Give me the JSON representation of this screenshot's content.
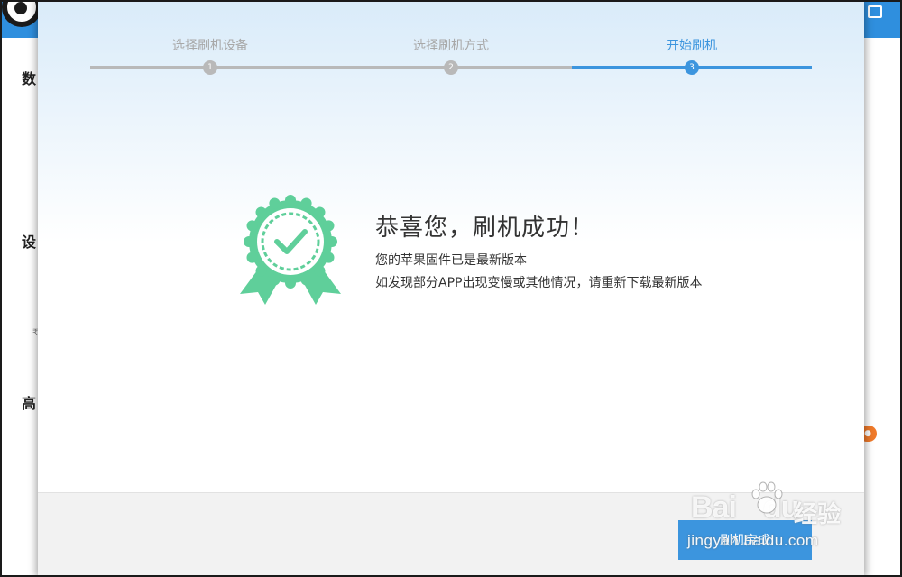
{
  "background_app": {
    "left_labels": [
      "数",
      "设",
      "高"
    ],
    "small_char": "₹"
  },
  "stepper": {
    "steps": [
      {
        "label": "选择刷机设备",
        "number": "1",
        "state": "done"
      },
      {
        "label": "选择刷机方式",
        "number": "2",
        "state": "done"
      },
      {
        "label": "开始刷机",
        "number": "3",
        "state": "active"
      }
    ]
  },
  "success": {
    "title": "恭喜您，刷机成功！",
    "line1": "您的苹果固件已是最新版本",
    "line2": "如发现部分APP出现变慢或其他情况，请重新下载最新版本",
    "icon": "award-check-icon"
  },
  "footer": {
    "finish_label": "刷机完成"
  },
  "watermark": {
    "brand": "Bai",
    "brand2": "du",
    "cn": "经验",
    "url": "jingyan.baidu.com"
  },
  "colors": {
    "accent": "#3c95de",
    "step_inactive": "#b9b9b9",
    "badge_green": "#5fcf9a",
    "titlebar": "#2f8fde"
  }
}
